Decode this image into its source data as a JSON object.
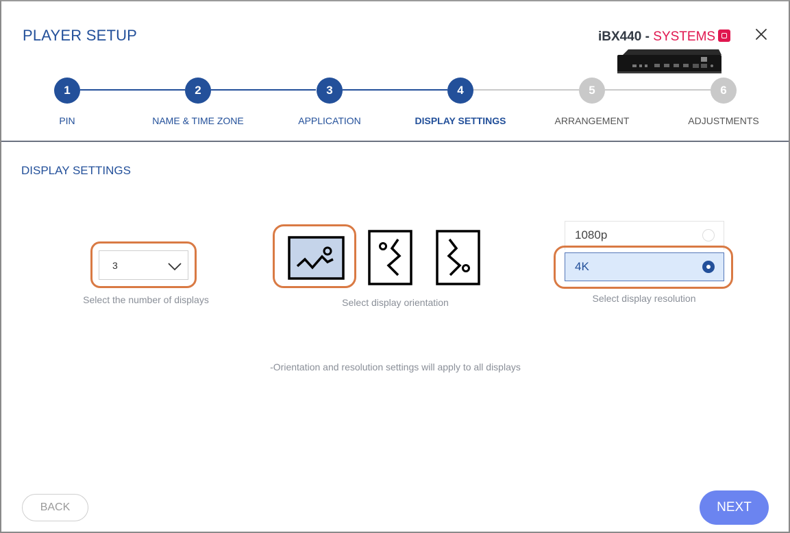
{
  "header": {
    "title": "PLAYER SETUP",
    "brand_model": "iBX440",
    "brand_separator": " - ",
    "brand_name": "SYSTEMS",
    "brand_color": "#e0164f",
    "close_icon": "close-icon"
  },
  "stepper": {
    "steps": [
      {
        "number": "1",
        "label": "PIN",
        "state": "done"
      },
      {
        "number": "2",
        "label": "NAME & TIME ZONE",
        "state": "done"
      },
      {
        "number": "3",
        "label": "APPLICATION",
        "state": "done"
      },
      {
        "number": "4",
        "label": "DISPLAY SETTINGS",
        "state": "active"
      },
      {
        "number": "5",
        "label": "ARRANGEMENT",
        "state": "todo"
      },
      {
        "number": "6",
        "label": "ADJUSTMENTS",
        "state": "todo"
      }
    ],
    "done_color": "#23509a",
    "todo_color": "#c9c9c9"
  },
  "section": {
    "title": "DISPLAY SETTINGS"
  },
  "displays": {
    "selected_value": "3",
    "caption": "Select the number of displays"
  },
  "orientation": {
    "options": [
      "landscape",
      "portrait-left",
      "portrait-right"
    ],
    "selected": "landscape",
    "caption": "Select display orientation"
  },
  "resolution": {
    "options": [
      {
        "label": "1080p",
        "selected": false
      },
      {
        "label": "4K",
        "selected": true
      }
    ],
    "caption": "Select display resolution"
  },
  "note": "-Orientation and resolution settings will apply to all displays",
  "footer": {
    "back_label": "BACK",
    "next_label": "NEXT",
    "next_color": "#6b84f0"
  },
  "highlight_color": "#d97a44"
}
